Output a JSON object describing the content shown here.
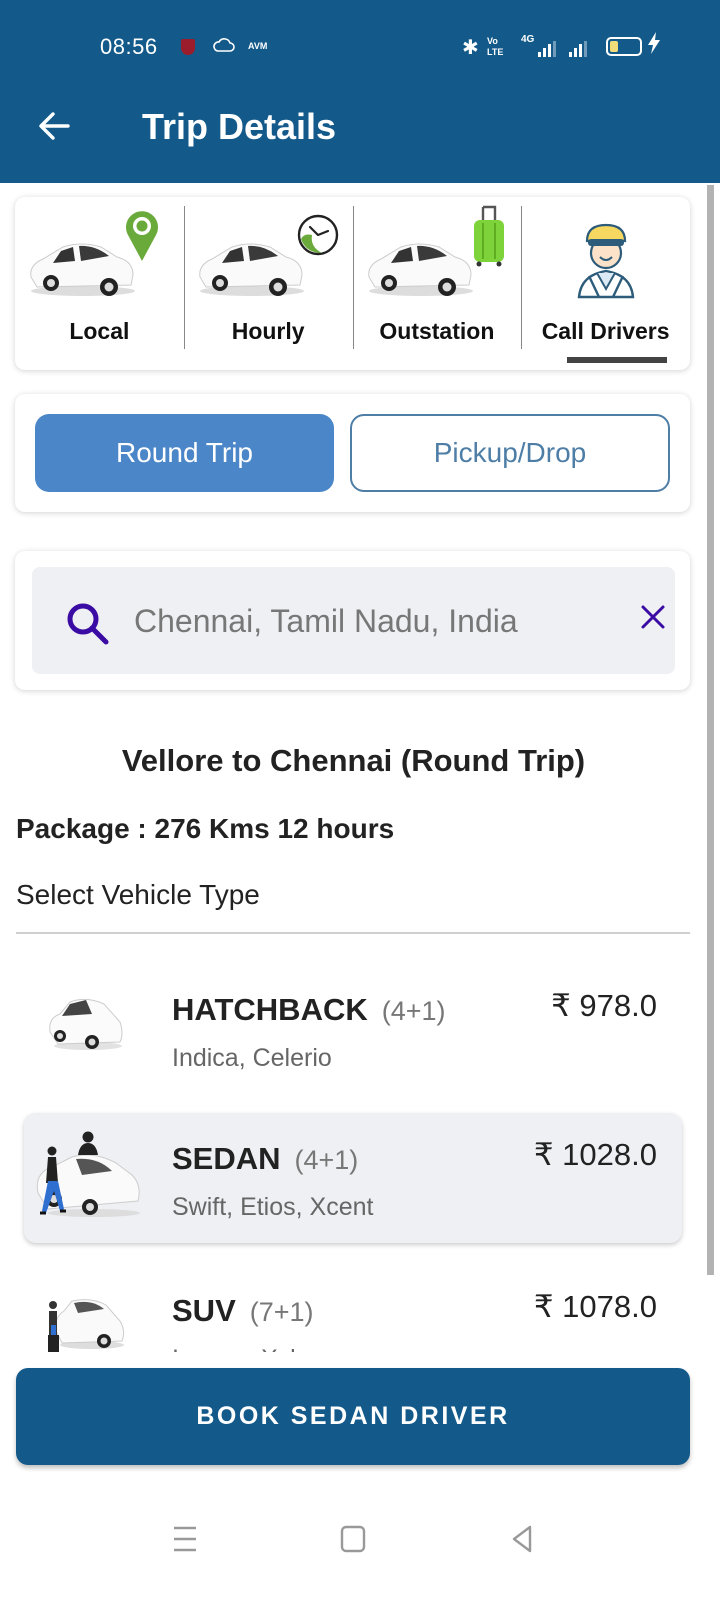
{
  "status_bar": {
    "time": "08:56",
    "notification_icons": [
      "mcafee-shield-icon",
      "cloud-icon",
      "avm-icon"
    ],
    "avm_label": "AVM",
    "bluetooth": "✱",
    "volte_label_top": "Vo",
    "volte_label_bottom": "LTE",
    "network_label": "4G",
    "battery_charging": true,
    "bolt": "⚡"
  },
  "app_bar": {
    "back_icon": "←",
    "title": "Trip Details"
  },
  "services": {
    "tabs": [
      {
        "label": "Local",
        "icon": "location-pin-icon",
        "selected": false
      },
      {
        "label": "Hourly",
        "icon": "clock-icon",
        "selected": false
      },
      {
        "label": "Outstation",
        "icon": "suitcase-icon",
        "selected": false
      },
      {
        "label": "Call Drivers",
        "icon": "driver-icon",
        "selected": true
      }
    ]
  },
  "trip_type": {
    "options": [
      {
        "label": "Round Trip",
        "selected": true
      },
      {
        "label": "Pickup/Drop",
        "selected": false
      }
    ]
  },
  "search": {
    "value": "Chennai, Tamil Nadu, India",
    "clear_icon": "×"
  },
  "trip_info": {
    "route_title": "Vellore to Chennai (Round Trip)",
    "package": "Package : 276 Kms 12 hours",
    "select_label": "Select Vehicle Type"
  },
  "vehicles": [
    {
      "name": "HATCHBACK",
      "seats": "(4+1)",
      "models": "Indica, Celerio",
      "price": "₹ 978.0",
      "selected": false
    },
    {
      "name": "SEDAN",
      "seats": "(4+1)",
      "models": "Swift, Etios, Xcent",
      "price": "₹ 1028.0",
      "selected": true
    },
    {
      "name": "SUV",
      "seats": "(7+1)",
      "models": "Innova, Xylo",
      "price": "₹ 1078.0",
      "selected": false
    }
  ],
  "book_button": {
    "label": "BOOK SEDAN DRIVER"
  },
  "colors": {
    "primary": "#135a8a",
    "accent_blue": "#4a86c8",
    "outline_blue": "#4e7ea6",
    "search_icon": "#3a0ca3",
    "green": "#6aaa3a",
    "selected_row": "#eff0f4"
  },
  "nav_bar": {
    "buttons": [
      "menu-icon",
      "home-icon",
      "back-icon"
    ]
  }
}
